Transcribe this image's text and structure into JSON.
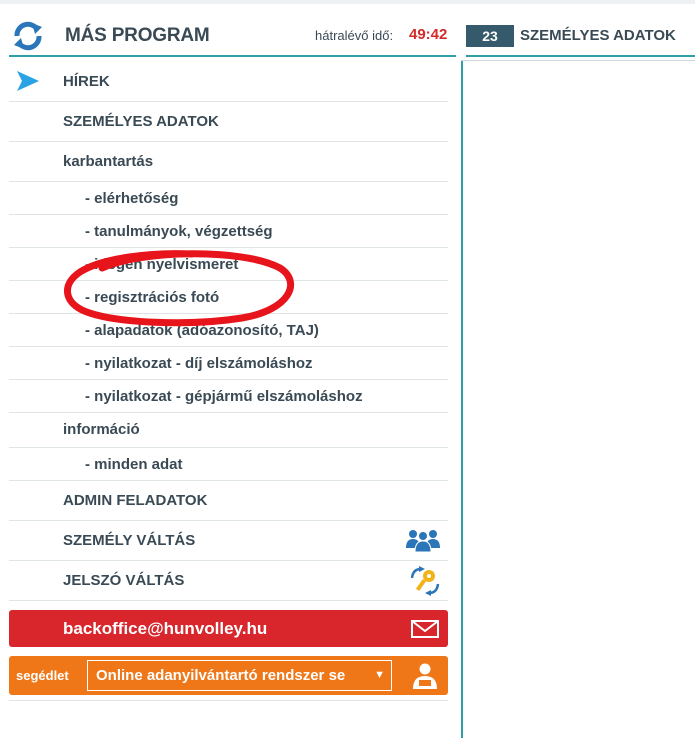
{
  "header": {
    "app_title": "MÁS PROGRAM",
    "timer_label": "hátralévő idő:",
    "timer_value": "49:42",
    "badge_count": "23",
    "right_title": "SZEMÉLYES ADATOK"
  },
  "menu": {
    "items": [
      {
        "label": "HÍREK"
      },
      {
        "label": "SZEMÉLYES ADATOK"
      },
      {
        "label": "karbantartás"
      },
      {
        "label": "- elérhetőség"
      },
      {
        "label": "- tanulmányok, végzettség"
      },
      {
        "label": "- idegen nyelvismeret"
      },
      {
        "label": "- regisztrációs fotó"
      },
      {
        "label": "- alapadatok (adóazonosító, TAJ)"
      },
      {
        "label": "- nyilatkozat - díj elszámoláshoz"
      },
      {
        "label": "- nyilatkozat - gépjármű elszámoláshoz"
      },
      {
        "label": "információ"
      },
      {
        "label": "- minden adat"
      },
      {
        "label": "ADMIN FELADATOK"
      },
      {
        "label": "SZEMÉLY VÁLTÁS"
      },
      {
        "label": "JELSZÓ VÁLTÁS"
      }
    ]
  },
  "email": {
    "address": "backoffice@hunvolley.hu"
  },
  "help": {
    "label": "segédlet",
    "selected": "Online adanyilvántartó rendszer se"
  },
  "colors": {
    "accent": "#2f9fa5",
    "timer": "#d42a2a",
    "email_bar": "#d8262c",
    "help_bar": "#ef7718",
    "badge": "#355a6b",
    "annotation": "#e8141c"
  },
  "icons": {
    "logo": "refresh-arrows-icon",
    "active": "arrow-right-icon",
    "switch_user": "people-group-icon",
    "password": "keys-icon",
    "email": "envelope-icon",
    "help": "person-icon"
  }
}
